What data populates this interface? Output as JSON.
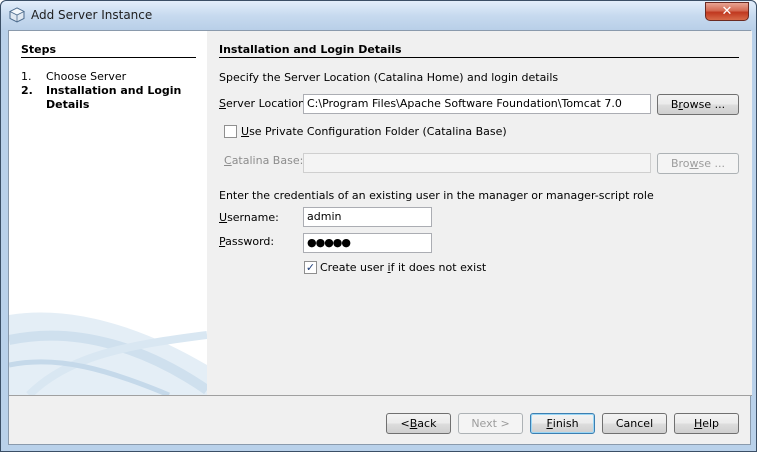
{
  "window": {
    "title": "Add Server Instance",
    "close_glyph": "✕"
  },
  "steps": {
    "title": "Steps",
    "items": [
      {
        "num": "1.",
        "label": "Choose Server"
      },
      {
        "num": "2.",
        "label": "Installation and Login Details"
      }
    ]
  },
  "panel": {
    "title": "Installation and Login Details",
    "intro": "Specify the Server Location (Catalina Home) and login details",
    "server_location_label": "Server Location:",
    "server_location_value": "C:\\Program Files\\Apache Software Foundation\\Tomcat 7.0",
    "browse_label": "Browse ...",
    "private_config_label": "Use Private Configuration Folder (Catalina Base)",
    "catalina_base_label": "Catalina Base:",
    "catalina_base_value": "",
    "browse2_label": "Browse ...",
    "credentials_text": "Enter the credentials of an existing user in the manager or manager-script role",
    "username_label": "Username:",
    "username_value": "admin",
    "password_label": "Password:",
    "password_value": "●●●●●",
    "create_user_label": "Create user if it does not exist",
    "create_user_checked": "✓"
  },
  "footer": {
    "back": "< Back",
    "next": "Next >",
    "finish": "Finish",
    "cancel": "Cancel",
    "help": "Help"
  }
}
